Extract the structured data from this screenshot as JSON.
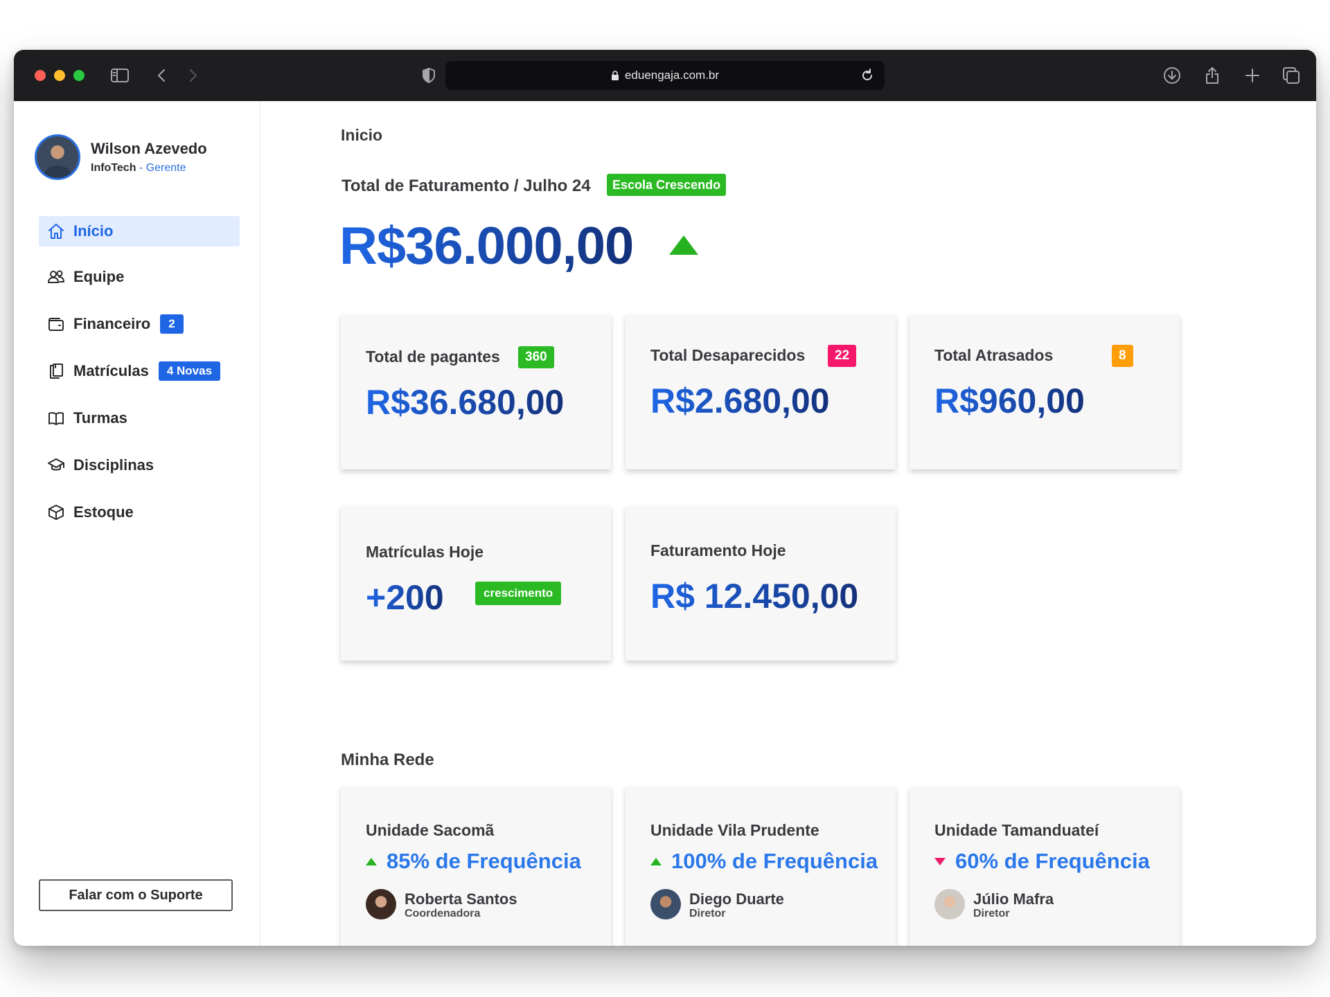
{
  "browser": {
    "url": "eduengaja.com.br"
  },
  "user": {
    "name": "Wilson Azevedo",
    "company": "InfoTech",
    "separator": " - ",
    "role": "Gerente"
  },
  "sidebar": {
    "items": [
      {
        "label": "Início",
        "icon": "home-icon",
        "active": true,
        "badge": ""
      },
      {
        "label": "Equipe",
        "icon": "users-icon",
        "active": false,
        "badge": ""
      },
      {
        "label": "Financeiro",
        "icon": "wallet-icon",
        "active": false,
        "badge": "2"
      },
      {
        "label": "Matrículas",
        "icon": "clipboard-icon",
        "active": false,
        "badge": "4 Novas"
      },
      {
        "label": "Turmas",
        "icon": "book-icon",
        "active": false,
        "badge": ""
      },
      {
        "label": "Disciplinas",
        "icon": "graduation-cap-icon",
        "active": false,
        "badge": ""
      },
      {
        "label": "Estoque",
        "icon": "box-icon",
        "active": false,
        "badge": ""
      }
    ],
    "support_button": "Falar com o Suporte"
  },
  "main": {
    "breadcrumb": "Inicio",
    "billing_title": "Total de Faturamento / Julho 24",
    "billing_badge": "Escola Crescendo",
    "billing_amount": "R$36.000,00",
    "stats": [
      {
        "label": "Total de pagantes",
        "badge": "360",
        "badge_color": "#2bba23",
        "value": "R$36.680,00"
      },
      {
        "label": "Total Desaparecidos",
        "badge": "22",
        "badge_color": "#f5176b",
        "value": "R$2.680,00"
      },
      {
        "label": "Total Atrasados",
        "badge": "8",
        "badge_color": "#ff9d0a",
        "value": "R$960,00"
      }
    ],
    "today": {
      "enrollments_label": "Matrículas Hoje",
      "enrollments_value": "+200",
      "enrollments_badge": "crescimento",
      "revenue_label": "Faturamento Hoje",
      "revenue_value": "R$ 12.450,00"
    },
    "network_title": "Minha Rede",
    "units": [
      {
        "name": "Unidade Sacomã",
        "frequency": "85% de Frequência",
        "trend": "up",
        "person": "Roberta Santos",
        "role": "Coordenadora"
      },
      {
        "name": "Unidade Vila Prudente",
        "frequency": "100% de Frequência",
        "trend": "up",
        "person": "Diego Duarte",
        "role": "Diretor"
      },
      {
        "name": "Unidade Tamanduateí",
        "frequency": "60% de Frequência",
        "trend": "down",
        "person": "Júlio Mafra",
        "role": "Diretor"
      }
    ]
  },
  "colors": {
    "accent": "#1f66e5",
    "success": "#2bba23",
    "danger": "#f5176b",
    "warning": "#ff9d0a"
  }
}
